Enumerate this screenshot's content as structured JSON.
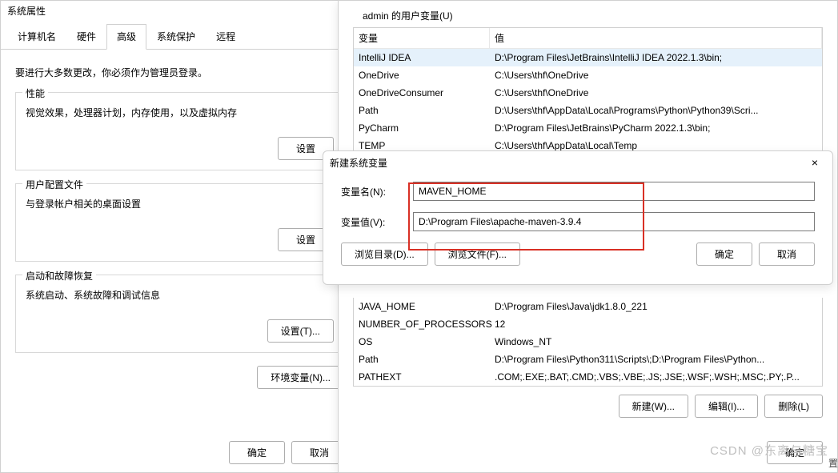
{
  "sysprop": {
    "title": "系统属性",
    "tabs": [
      "计算机名",
      "硬件",
      "高级",
      "系统保护",
      "远程"
    ],
    "active_tab": 2,
    "notice": "要进行大多数更改，你必须作为管理员登录。",
    "perf": {
      "legend": "性能",
      "desc": "视觉效果，处理器计划，内存使用，以及虚拟内存",
      "btn": "设置"
    },
    "userprof": {
      "legend": "用户配置文件",
      "desc": "与登录帐户相关的桌面设置",
      "btn": "设置"
    },
    "startup": {
      "legend": "启动和故障恢复",
      "desc": "系统启动、系统故障和调试信息",
      "btn": "设置(T)..."
    },
    "env_btn": "环境变量(N)...",
    "ok": "确定",
    "cancel": "取消"
  },
  "envvars": {
    "user_section": "admin 的用户变量(U)",
    "col_var": "变量",
    "col_val": "值",
    "user_vars": [
      {
        "name": "IntelliJ IDEA",
        "value": "D:\\Program Files\\JetBrains\\IntelliJ IDEA 2022.1.3\\bin;"
      },
      {
        "name": "OneDrive",
        "value": "C:\\Users\\thf\\OneDrive"
      },
      {
        "name": "OneDriveConsumer",
        "value": "C:\\Users\\thf\\OneDrive"
      },
      {
        "name": "Path",
        "value": "D:\\Users\\thf\\AppData\\Local\\Programs\\Python\\Python39\\Scri..."
      },
      {
        "name": "PyCharm",
        "value": "D:\\Program Files\\JetBrains\\PyCharm 2022.1.3\\bin;"
      },
      {
        "name": "TEMP",
        "value": "C:\\Users\\thf\\AppData\\Local\\Temp"
      }
    ],
    "sys_vars": [
      {
        "name": "JAVA_HOME",
        "value": "D:\\Program Files\\Java\\jdk1.8.0_221"
      },
      {
        "name": "NUMBER_OF_PROCESSORS",
        "value": "12"
      },
      {
        "name": "OS",
        "value": "Windows_NT"
      },
      {
        "name": "Path",
        "value": "D:\\Program Files\\Python311\\Scripts\\;D:\\Program Files\\Python..."
      },
      {
        "name": "PATHEXT",
        "value": ".COM;.EXE;.BAT;.CMD;.VBS;.VBE;.JS;.JSE;.WSF;.WSH;.MSC;.PY;.P..."
      }
    ],
    "new": "新建(W)...",
    "edit": "编辑(I)...",
    "delete": "删除(L)",
    "ok": "确定"
  },
  "newvar": {
    "title": "新建系统变量",
    "name_label": "变量名(N):",
    "name_value": "MAVEN_HOME",
    "value_label": "变量值(V):",
    "value_value": "D:\\Program Files\\apache-maven-3.9.4",
    "browse_dir": "浏览目录(D)...",
    "browse_file": "浏览文件(F)...",
    "ok": "确定",
    "cancel": "取消"
  },
  "watermark": "CSDN @东离与糖宝",
  "side_char": "置"
}
